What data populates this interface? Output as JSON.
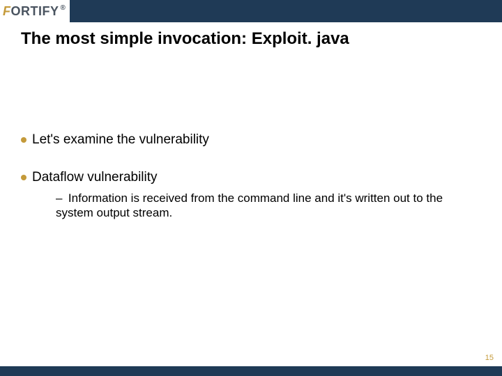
{
  "logo": {
    "brand": "ORTIFY",
    "leading_letter": "F",
    "trademark": "®"
  },
  "title": "The most simple invocation: Exploit. java",
  "bullets": [
    {
      "text": "Let's examine the vulnerability",
      "subs": []
    },
    {
      "text": "Dataflow vulnerability",
      "subs": [
        "Information is received from the command line and it's written out to the system output stream."
      ]
    }
  ],
  "page_number": "15"
}
